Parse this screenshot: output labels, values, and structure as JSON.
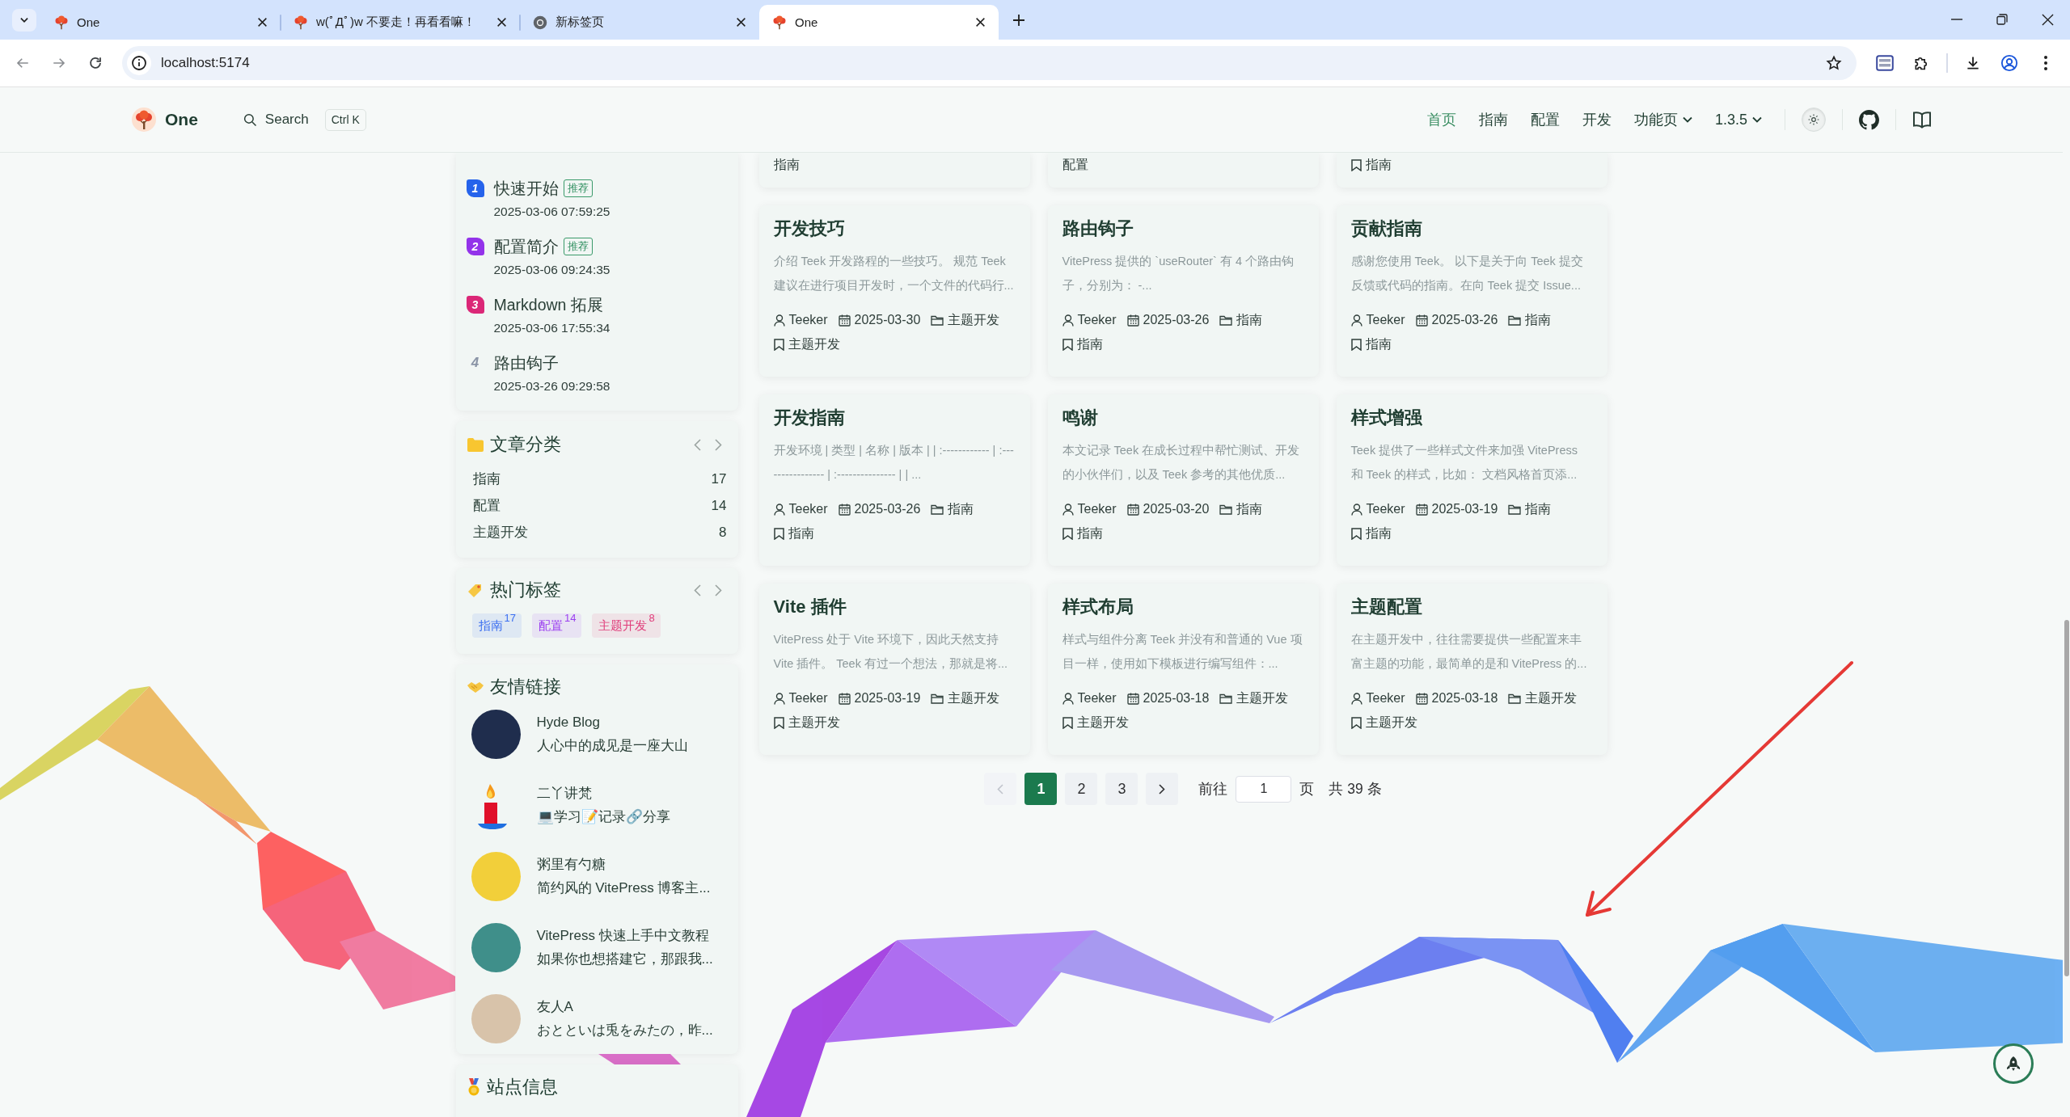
{
  "browser": {
    "tabs": [
      {
        "title": "One",
        "kind": "site",
        "selected": false
      },
      {
        "title": "w(ﾟДﾟ)w 不要走！再看看嘛！",
        "kind": "site",
        "selected": false
      },
      {
        "title": "新标签页",
        "kind": "newtab",
        "selected": false
      },
      {
        "title": "One",
        "kind": "site",
        "selected": true
      }
    ],
    "address": "localhost:5174"
  },
  "nav": {
    "logo": "One",
    "search": {
      "label": "Search",
      "shortcut": "Ctrl K"
    },
    "links": [
      {
        "label": "首页",
        "kind": "link",
        "selected": true
      },
      {
        "label": "指南",
        "kind": "link",
        "selected": false
      },
      {
        "label": "配置",
        "kind": "link",
        "selected": false
      },
      {
        "label": "开发",
        "kind": "link",
        "selected": false
      },
      {
        "label": "功能页",
        "kind": "menu",
        "selected": false
      },
      {
        "label": "1.3.5",
        "kind": "menu",
        "selected": false
      }
    ]
  },
  "sidebar": {
    "featured": {
      "items": [
        {
          "rank": "1",
          "title": "快速开始",
          "tag": "推荐",
          "date": "2025-03-06 07:59:25",
          "color": "#2563eb"
        },
        {
          "rank": "2",
          "title": "配置简介",
          "tag": "推荐",
          "date": "2025-03-06 09:24:35",
          "color": "#9333ea"
        },
        {
          "rank": "3",
          "title": "Markdown 拓展",
          "date": "2025-03-06 17:55:34",
          "color": "#db2777"
        },
        {
          "rank": "4",
          "title": "路由钩子",
          "date": "2025-03-26 09:29:58"
        }
      ]
    },
    "categories": {
      "title": "文章分类",
      "items": [
        {
          "name": "指南",
          "count": "17"
        },
        {
          "name": "配置",
          "count": "14"
        },
        {
          "name": "主题开发",
          "count": "8"
        }
      ]
    },
    "tags": {
      "title": "热门标签",
      "items": [
        {
          "name": "指南",
          "count": "17",
          "color": "#3c6ff0"
        },
        {
          "name": "配置",
          "count": "14",
          "color": "#9b3ff0"
        },
        {
          "name": "主题开发",
          "count": "8",
          "color": "#e03c7a"
        }
      ]
    },
    "friends": {
      "title": "友情链接",
      "items": [
        {
          "name": "Hyde Blog",
          "description": "人心中的成见是一座大山",
          "kind": "picture"
        },
        {
          "name": "二丫讲梵",
          "description": "💻学习📝记录🔗分享",
          "kind": "candle"
        },
        {
          "name": "粥里有勺糖",
          "description": "简约风的 VitePress 博客主...",
          "kind": "picture"
        },
        {
          "name": "VitePress 快速上手中文教程",
          "description": "如果你也想搭建它，那跟我...",
          "kind": "picture"
        },
        {
          "name": "友人A",
          "description": "おとといは兎をみたの，昨...",
          "kind": "picture"
        }
      ]
    },
    "site_info": {
      "title": "站点信息"
    }
  },
  "articles": {
    "partial_cards": [
      {
        "kind": "text",
        "label": "指南"
      },
      {
        "kind": "text",
        "label": "配置"
      },
      {
        "kind": "tag",
        "label": "指南"
      }
    ],
    "cards": [
      {
        "title": "开发技巧",
        "excerpt": "介绍 Teek 开发路程的一些技巧。 规范 Teek 建议在进行项目开发时，一个文件的代码行...",
        "author": "Teeker",
        "date": "2025-03-30",
        "category": "主题开发",
        "tag": "主题开发"
      },
      {
        "title": "路由钩子",
        "excerpt": "VitePress 提供的 `useRouter` 有 4 个路由钩子，分别为： -...",
        "author": "Teeker",
        "date": "2025-03-26",
        "category": "指南",
        "tag": "指南"
      },
      {
        "title": "贡献指南",
        "excerpt": "感谢您使用 Teek。 以下是关于向 Teek 提交反馈或代码的指南。在向 Teek 提交 Issue...",
        "author": "Teeker",
        "date": "2025-03-26",
        "category": "指南",
        "tag": "指南"
      },
      {
        "title": "开发指南",
        "excerpt": "开发环境 | 类型 | 名称 | 版本 | | :------------ | :---------------- | :--------------- | | ...",
        "author": "Teeker",
        "date": "2025-03-26",
        "category": "指南",
        "tag": "指南"
      },
      {
        "title": "鸣谢",
        "excerpt": "本文记录 Teek 在成长过程中帮忙测试、开发的小伙伴们，以及 Teek 参考的其他优质...",
        "author": "Teeker",
        "date": "2025-03-20",
        "category": "指南",
        "tag": "指南"
      },
      {
        "title": "样式增强",
        "excerpt": "Teek 提供了一些样式文件来加强 VitePress 和 Teek 的样式，比如： 文档风格首页添...",
        "author": "Teeker",
        "date": "2025-03-19",
        "category": "指南",
        "tag": "指南"
      },
      {
        "title": "Vite 插件",
        "excerpt": "VitePress 处于 Vite 环境下，因此天然支持 Vite 插件。 Teek 有过一个想法，那就是将...",
        "author": "Teeker",
        "date": "2025-03-19",
        "category": "主题开发",
        "tag": "主题开发"
      },
      {
        "title": "样式布局",
        "excerpt": "样式与组件分离 Teek 并没有和普通的 Vue 项目一样，使用如下模板进行编写组件：...",
        "author": "Teeker",
        "date": "2025-03-18",
        "category": "主题开发",
        "tag": "主题开发"
      },
      {
        "title": "主题配置",
        "excerpt": "在主题开发中，往往需要提供一些配置来丰富主题的功能，最简单的是和 VitePress 的...",
        "author": "Teeker",
        "date": "2025-03-18",
        "category": "主题开发",
        "tag": "主题开发"
      }
    ]
  },
  "pagination": {
    "prev": {
      "disabled": true
    },
    "pages": [
      {
        "label": "1",
        "selected": true
      },
      {
        "label": "2",
        "selected": false
      },
      {
        "label": "3",
        "selected": false
      }
    ],
    "next": {
      "disabled": false
    },
    "jump": {
      "label": "前往",
      "value": "1",
      "unit": "页"
    },
    "total": "共 39 条"
  }
}
